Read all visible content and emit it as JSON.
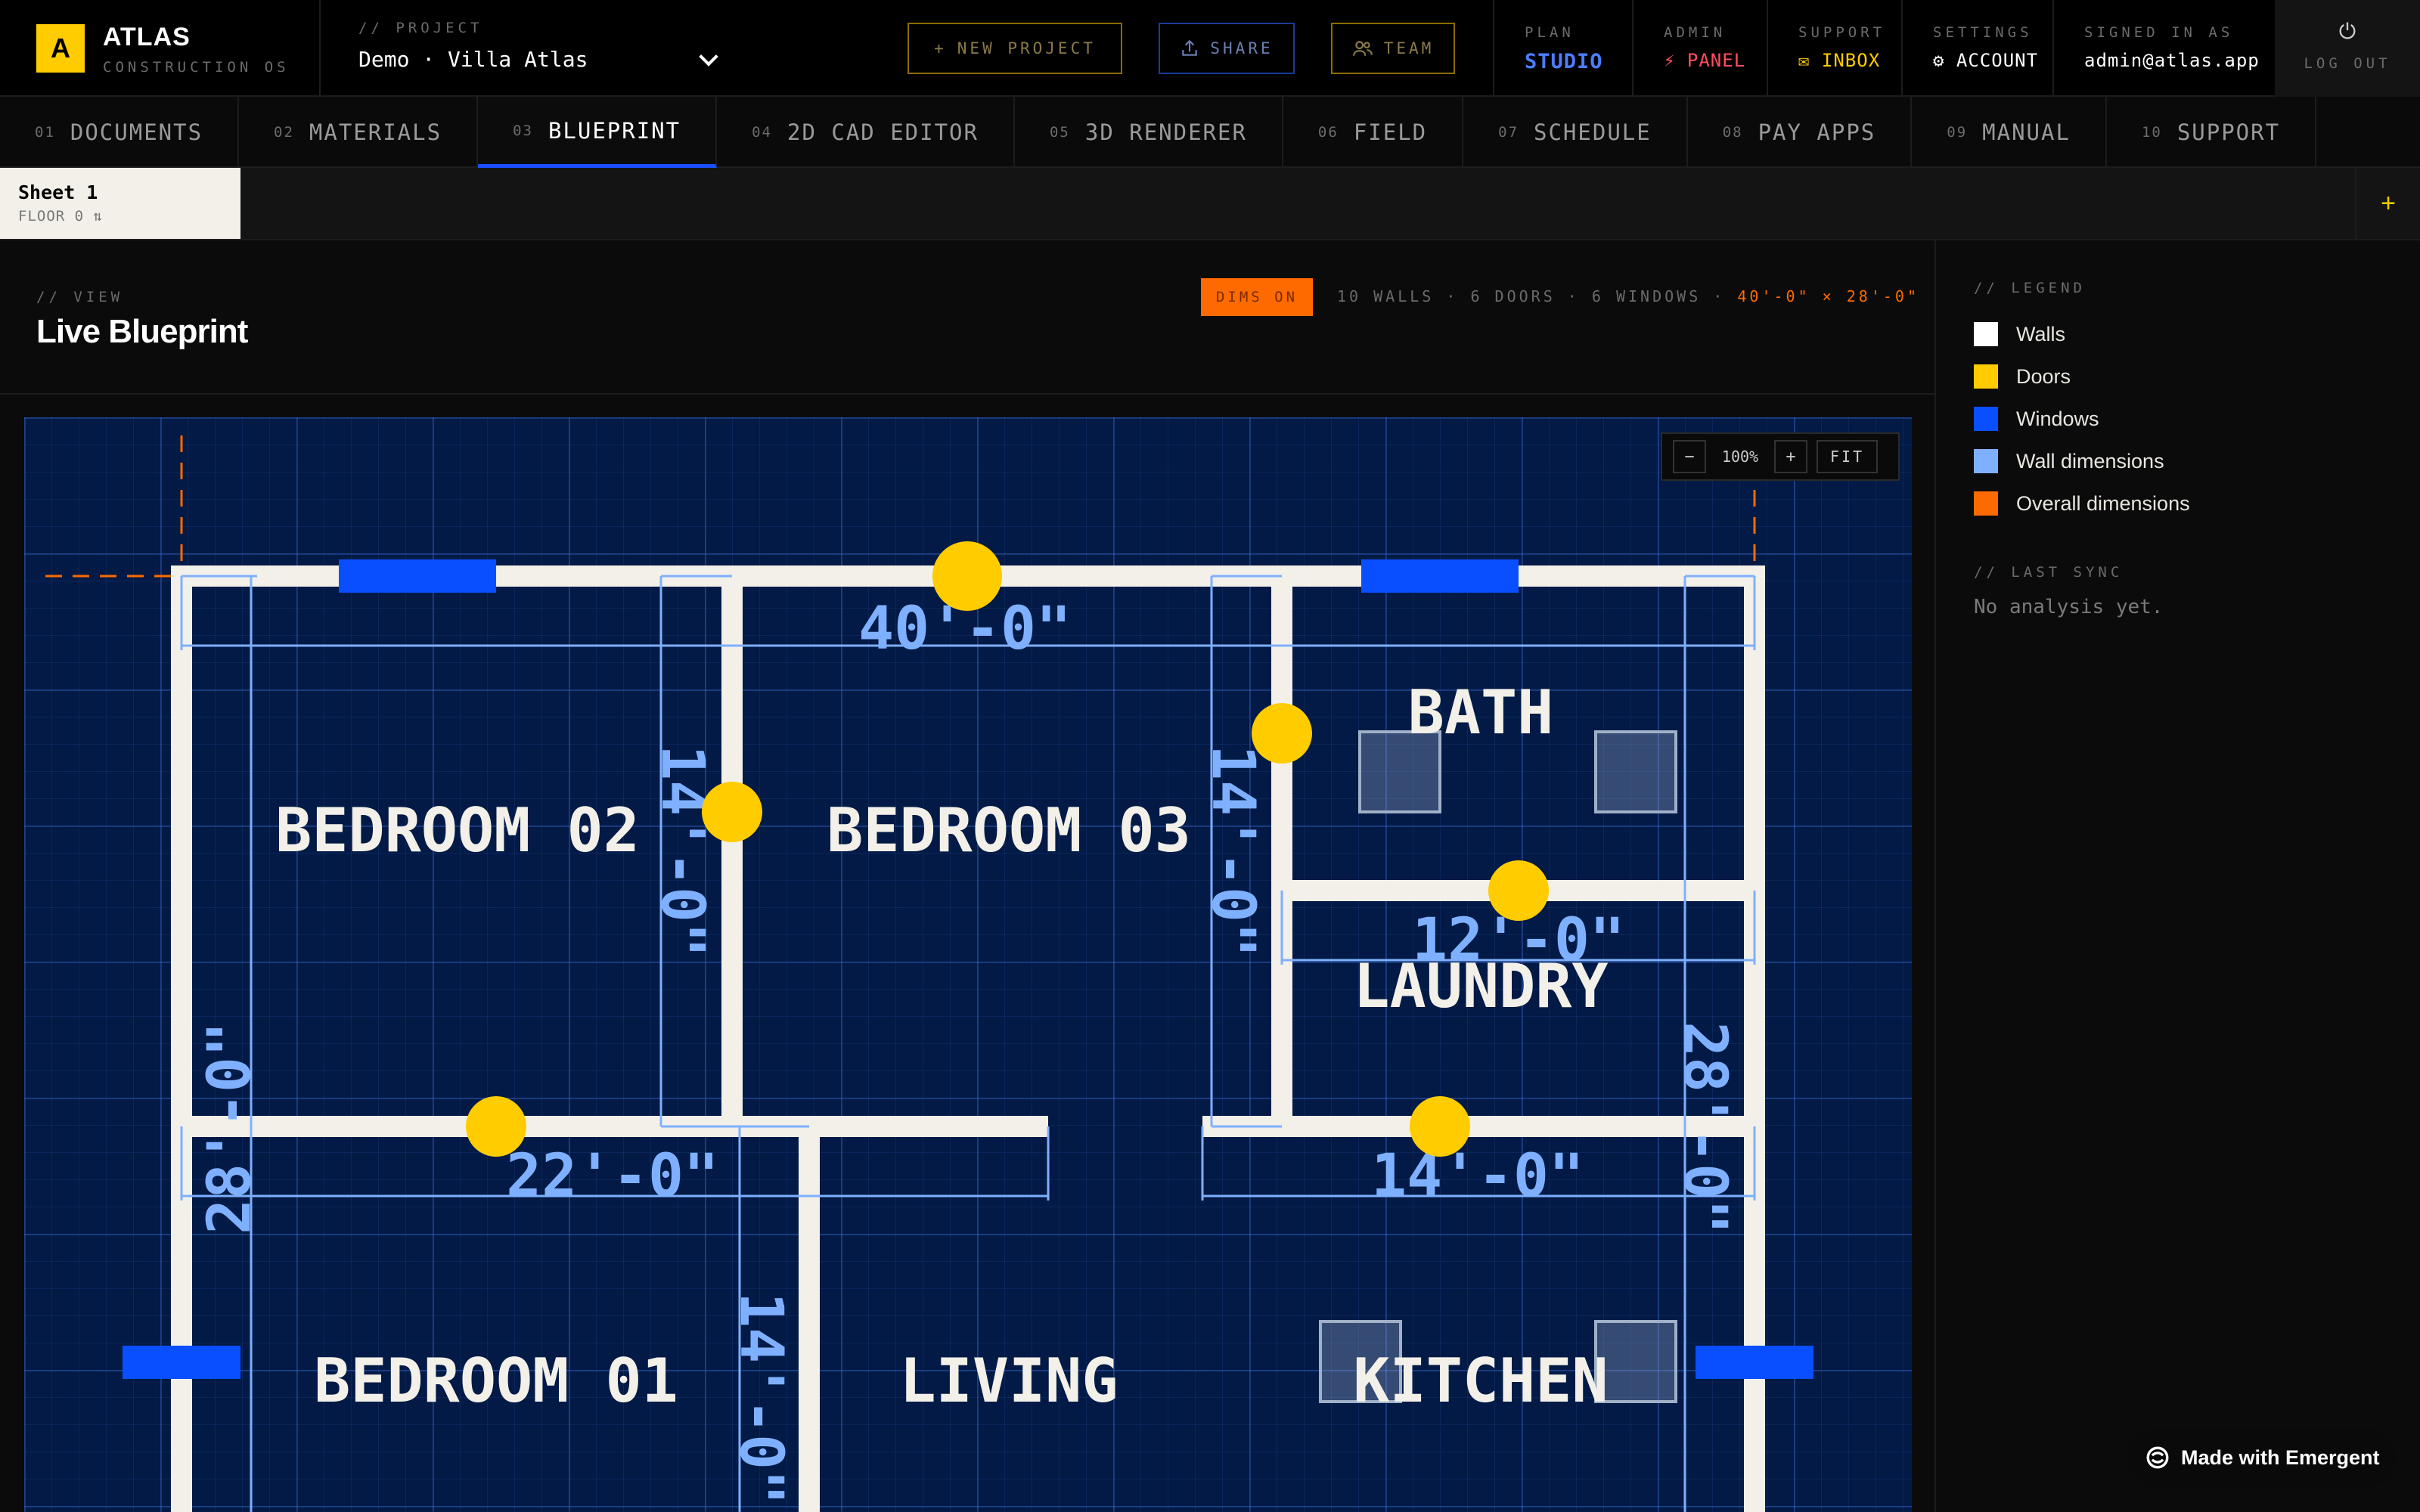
{
  "brand": {
    "logo": "A",
    "name": "ATLAS",
    "subtitle": "CONSTRUCTION OS"
  },
  "project": {
    "label": "// PROJECT",
    "value": "Demo · Villa Atlas"
  },
  "toolbar": {
    "new_project": "NEW PROJECT",
    "share": "SHARE",
    "team": "TEAM"
  },
  "nav": {
    "plan": {
      "label": "PLAN",
      "value": "STUDIO",
      "color": "#4d7cff"
    },
    "admin": {
      "label": "ADMIN",
      "value": "⚡ PANEL",
      "color": "#ff4d5e"
    },
    "support": {
      "label": "SUPPORT",
      "value": "✉ INBOX",
      "color": "#ffcc00"
    },
    "settings": {
      "label": "SETTINGS",
      "value": "⚙ ACCOUNT"
    },
    "signed": {
      "label": "SIGNED IN AS",
      "value": "admin@atlas.app"
    },
    "logout": {
      "icon": "logout-icon",
      "label": "LOG OUT"
    }
  },
  "tabs": [
    {
      "num": "01",
      "label": "DOCUMENTS"
    },
    {
      "num": "02",
      "label": "MATERIALS"
    },
    {
      "num": "03",
      "label": "BLUEPRINT",
      "active": true
    },
    {
      "num": "04",
      "label": "2D CAD EDITOR"
    },
    {
      "num": "05",
      "label": "3D RENDERER"
    },
    {
      "num": "06",
      "label": "FIELD"
    },
    {
      "num": "07",
      "label": "SCHEDULE"
    },
    {
      "num": "08",
      "label": "PAY APPS"
    },
    {
      "num": "09",
      "label": "MANUAL"
    },
    {
      "num": "10",
      "label": "SUPPORT"
    }
  ],
  "sheet": {
    "name": "Sheet 1",
    "floor": "FLOOR 0",
    "add": "+"
  },
  "view": {
    "label": "// VIEW",
    "title": "Live Blueprint",
    "dims_toggle": "DIMS ON",
    "stats": "10 WALLS · 6 DOORS · 6 WINDOWS",
    "overall": "40'-0\" × 28'-0\""
  },
  "zoom": {
    "minus": "−",
    "value": "100%",
    "plus": "+",
    "fit": "FIT"
  },
  "blueprint": {
    "rooms": [
      "BEDROOM 02",
      "BEDROOM 03",
      "BATH",
      "LAUNDRY",
      "BEDROOM 01",
      "LIVING",
      "KITCHEN"
    ],
    "dims": {
      "overall_width": "40'-0\"",
      "overall_depth_left": "28'-0\"",
      "overall_depth_right": "28'-0\"",
      "br02_depth": "14'-0\"",
      "br03_depth": "14'-0\"",
      "laundry_width": "12'-0\"",
      "bedroom01_width": "22'-0\"",
      "kitchen_width": "14'-0\"",
      "bedroom01_depth": "14'-0\""
    },
    "colors": {
      "wall": "#f2f0e8",
      "door": "#ffcc00",
      "window": "#0a4fff",
      "dimension": "#7fb0ff",
      "overall": "#ff6a00",
      "background": "#021a45"
    }
  },
  "legend": {
    "label": "// LEGEND",
    "items": [
      {
        "label": "Walls",
        "color": "#ffffff"
      },
      {
        "label": "Doors",
        "color": "#ffcc00"
      },
      {
        "label": "Windows",
        "color": "#0a4fff"
      },
      {
        "label": "Wall dimensions",
        "color": "#7fb0ff"
      },
      {
        "label": "Overall dimensions",
        "color": "#ff6a00"
      }
    ]
  },
  "sync": {
    "label": "// LAST SYNC",
    "text": "No analysis yet."
  },
  "badge": {
    "text": "Made with Emergent"
  }
}
